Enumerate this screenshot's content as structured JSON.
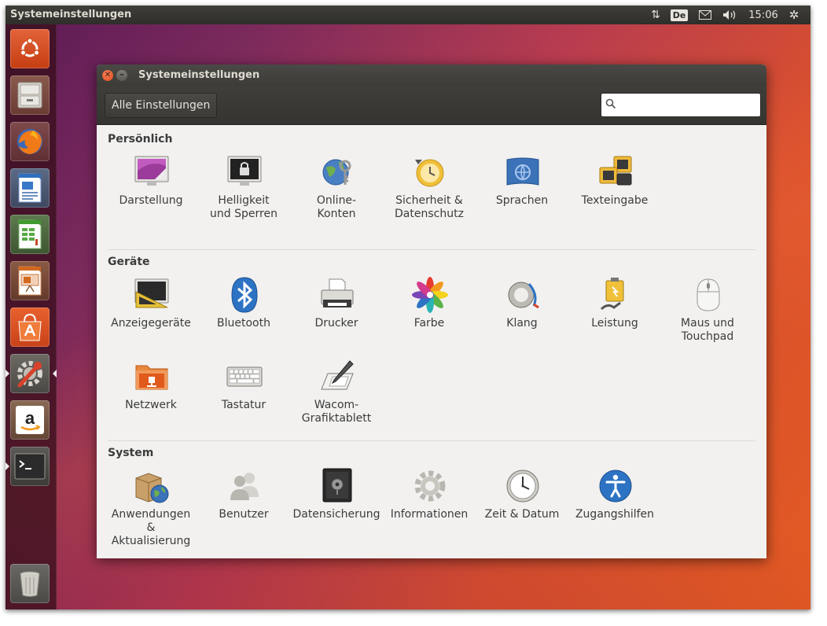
{
  "top_panel": {
    "title": "Systemeinstellungen",
    "keyboard_layout": "De",
    "clock": "15:06"
  },
  "launcher": {
    "items": [
      "ubuntu-dash-icon",
      "files-icon",
      "firefox-icon",
      "libreoffice-writer-icon",
      "libreoffice-calc-icon",
      "libreoffice-impress-icon",
      "software-center-icon",
      "system-settings-icon",
      "amazon-icon",
      "terminal-icon",
      "trash-icon"
    ]
  },
  "window": {
    "title": "Systemeinstellungen",
    "all_settings_label": "Alle Einstellungen",
    "search": {
      "value": "",
      "placeholder": ""
    },
    "sections": {
      "personal": {
        "title": "Persönlich",
        "items": {
          "appearance": "Darstellung",
          "brightness": "Helligkeit\nund Sperren",
          "online": "Online-\nKonten",
          "security": "Sicherheit &\nDatenschutz",
          "language": "Sprachen",
          "text_entry": "Texteingabe"
        }
      },
      "hardware": {
        "title": "Geräte",
        "items": {
          "displays": "Anzeigegeräte",
          "bluetooth": "Bluetooth",
          "printers": "Drucker",
          "color": "Farbe",
          "sound": "Klang",
          "power": "Leistung",
          "mouse": "Maus und\nTouchpad",
          "network": "Netzwerk",
          "keyboard": "Tastatur",
          "wacom": "Wacom-\nGrafiktablett"
        }
      },
      "system": {
        "title": "System",
        "items": {
          "software": "Anwendungen\n&\nAktualisierung",
          "users": "Benutzer",
          "backups": "Datensicherung",
          "details": "Informationen",
          "time": "Zeit & Datum",
          "accessibility": "Zugangshilfen"
        }
      }
    }
  },
  "colors": {
    "accent": "#e95420",
    "panel": "#3c3b37",
    "content_bg": "#f2f1f0"
  }
}
